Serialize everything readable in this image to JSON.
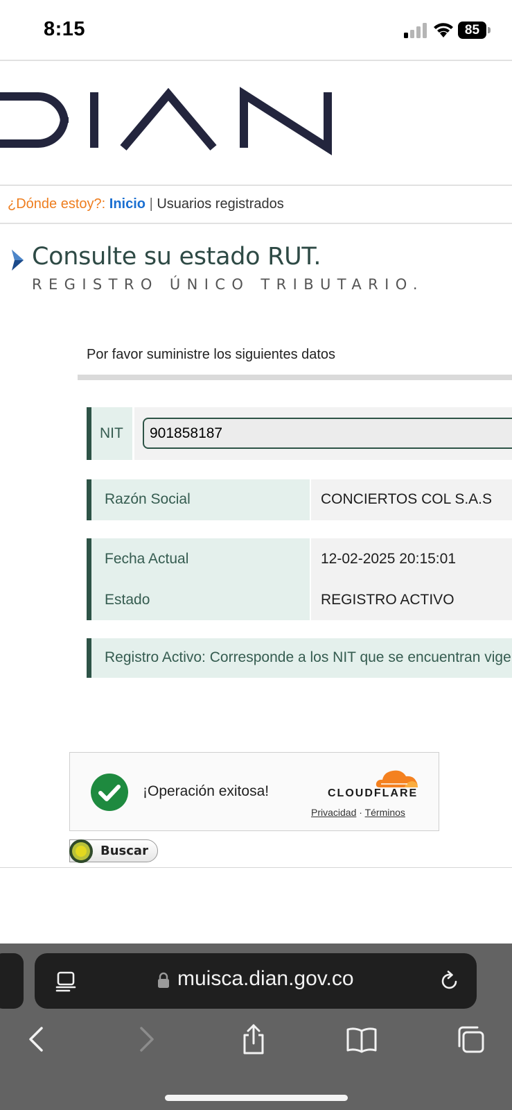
{
  "status_bar": {
    "time": "8:15",
    "battery_level": "85",
    "icons": [
      "cellular-signal-icon",
      "wifi-icon",
      "battery-icon"
    ]
  },
  "logo_text": "DIAN",
  "breadcrumb": {
    "label": "¿Dónde estoy?:",
    "home": "Inicio",
    "separator": "|",
    "current": "Usuarios registrados"
  },
  "heading": {
    "title": "Consulte su estado RUT.",
    "subtitle": "REGISTRO ÚNICO TRIBUTARIO."
  },
  "form": {
    "instructions": "Por favor suministre los siguientes datos",
    "nit_label": "NIT",
    "nit_value": "901858187",
    "razon_social_label": "Razón Social",
    "razon_social_value": "CONCIERTOS COL S.A.S",
    "fecha_label": "Fecha Actual",
    "fecha_value": "12-02-2025 20:15:01",
    "estado_label": "Estado",
    "estado_value": "REGISTRO ACTIVO",
    "note": "Registro Activo: Corresponde a los NIT que se encuentran vige"
  },
  "captcha": {
    "message": "¡Operación exitosa!",
    "brand": "CLOUDFLARE",
    "privacy_link": "Privacidad",
    "link_separator": "·",
    "terms_link": "Términos"
  },
  "buscar_label": "Buscar",
  "browser": {
    "url": "muisca.dian.gov.co"
  },
  "colors": {
    "accent_green": "#2d5346",
    "label_bg": "#e4f0ec",
    "breadcrumb_orange": "#ee7d1e",
    "link_blue": "#1a6fd1",
    "logo_navy": "#23253d",
    "cloudflare_orange": "#f48120",
    "success_green": "#1e8a3f"
  }
}
